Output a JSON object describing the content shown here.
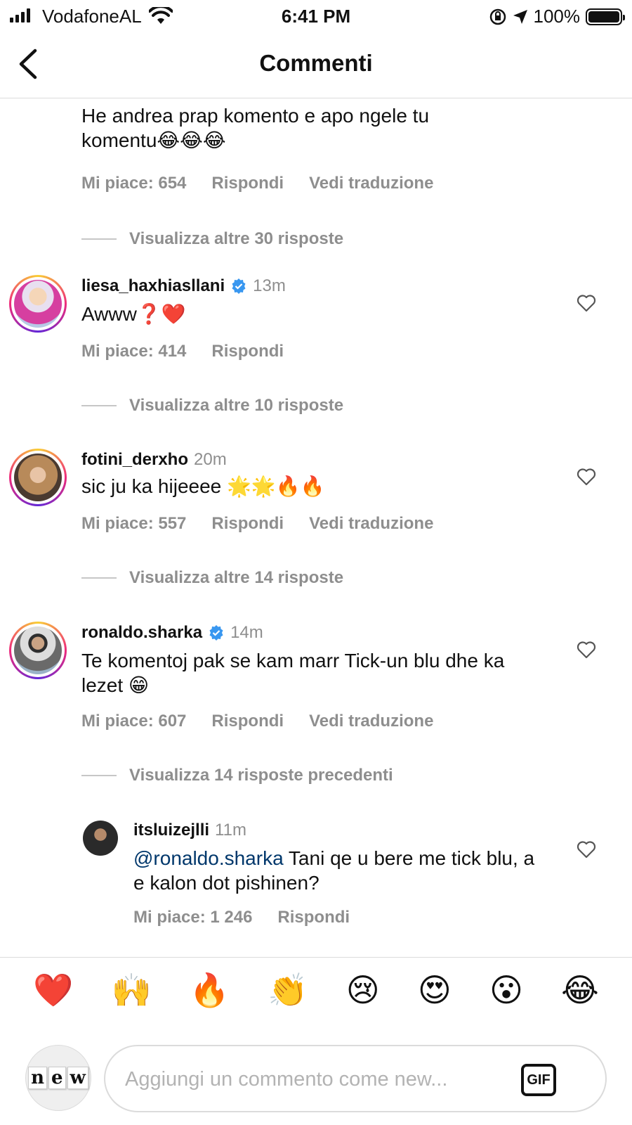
{
  "status_bar": {
    "carrier": "VodafoneAL",
    "time": "6:41 PM",
    "battery": "100%"
  },
  "header": {
    "title": "Commenti"
  },
  "top_comment": {
    "text": "He andrea prap komento e apo ngele tu komentu😂😂😂",
    "likes": "Mi piace: 654",
    "reply": "Rispondi",
    "translate": "Vedi traduzione",
    "view_more": "Visualizza altre 30 risposte"
  },
  "comments": [
    {
      "username": "liesa_haxhiasllani",
      "verified": true,
      "time": "13m",
      "text": "Awww❓❤️",
      "likes": "Mi piace: 414",
      "reply": "Rispondi",
      "view_more": "Visualizza altre 10 risposte"
    },
    {
      "username": "fotini_derxho",
      "verified": false,
      "time": "20m",
      "text": "sic ju ka hijeeee 🌟🌟🔥🔥",
      "likes": "Mi piace: 557",
      "reply": "Rispondi",
      "translate": "Vedi traduzione",
      "view_more": "Visualizza altre 14 risposte"
    },
    {
      "username": "ronaldo.sharka",
      "verified": true,
      "time": "14m",
      "text": "Te komentoj pak se kam marr Tick-un blu dhe ka lezet 😁",
      "likes": "Mi piace: 607",
      "reply": "Rispondi",
      "translate": "Vedi traduzione",
      "view_more": "Visualizza 14 risposte precedenti"
    }
  ],
  "reply": {
    "username": "itsluizejlli",
    "time": "11m",
    "mention": "@ronaldo.sharka",
    "text": " Tani qe u bere me tick blu, a e kalon dot pishinen?",
    "likes": "Mi piace: 1 246",
    "reply": "Rispondi"
  },
  "emoji_bar": [
    "❤️",
    "🙌",
    "🔥",
    "👏",
    "😢",
    "😍",
    "😮",
    "😂"
  ],
  "input": {
    "placeholder": "Aggiungi un commento come new...",
    "gif_label": "GIF",
    "avatar_letters": [
      "n",
      "e",
      "w"
    ]
  },
  "colors": {
    "muted": "#8e8e8e",
    "mention": "#00376b",
    "verified": "#3897f0"
  }
}
